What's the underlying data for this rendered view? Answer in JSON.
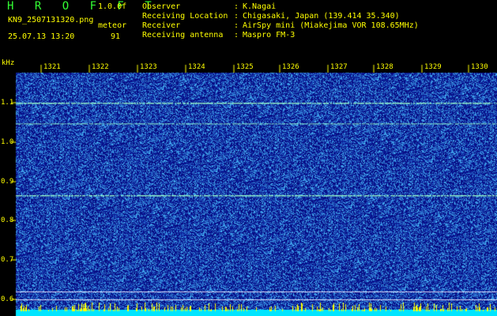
{
  "header": {
    "app_title": "H R O F F T",
    "app_version": "1.0.0f",
    "file_name": "KN9_2507131320.png",
    "mode_label": "meteor",
    "datetime": "25.07.13 13:20",
    "count_value": "91"
  },
  "info": [
    {
      "label": "Observer",
      "value": "K.Nagai"
    },
    {
      "label": "Receiving Location",
      "value": "Chigasaki, Japan (139.414 35.340)"
    },
    {
      "label": "Receiver",
      "value": "AirSpy mini (Miakejima VOR 108.65MHz)"
    },
    {
      "label": "Receiving antenna",
      "value": "Maspro FM-3"
    }
  ],
  "info_separator": ":",
  "axis": {
    "y_unit": "kHz",
    "y_ticks": [
      "1.1",
      "1.0",
      "0.9",
      "0.8",
      "0.7",
      "0.6"
    ],
    "x_ticks": [
      "1321",
      "1322",
      "1323",
      "1324",
      "1325",
      "1326",
      "1327",
      "1328",
      "1329",
      "1330"
    ]
  },
  "colors": {
    "background": "#0a0a8a",
    "noise": "#3aa0ff",
    "signal": "#9cffc8",
    "baseline": "#00e5ff",
    "peaks": "#ffff00",
    "text": "#ffff00"
  }
}
